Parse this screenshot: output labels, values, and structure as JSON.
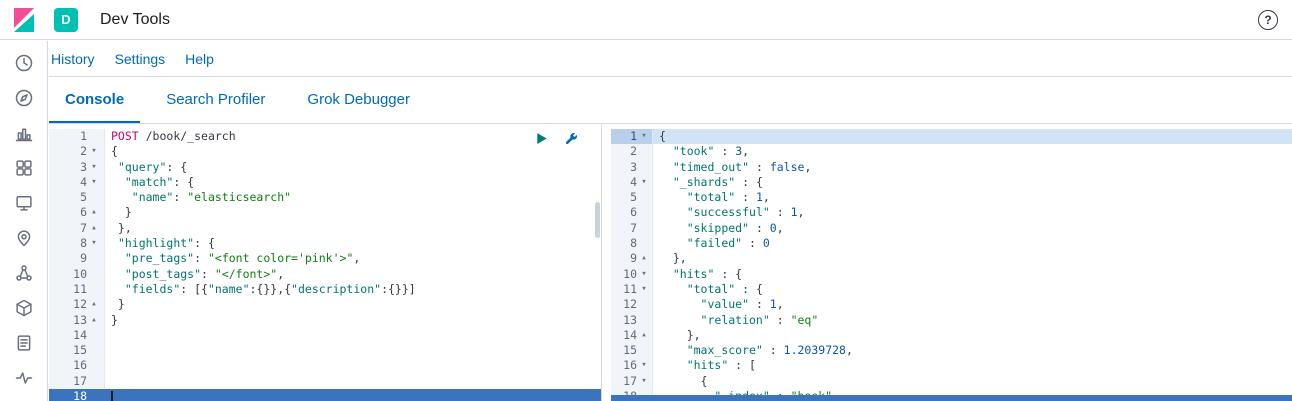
{
  "header": {
    "title": "Dev Tools",
    "space_badge": "D"
  },
  "topnav": {
    "links": [
      "History",
      "Settings",
      "Help"
    ]
  },
  "tabs": [
    {
      "label": "Console",
      "active": true
    },
    {
      "label": "Search Profiler",
      "active": false
    },
    {
      "label": "Grok Debugger",
      "active": false
    }
  ],
  "sidebar": {
    "icons": [
      "recently-viewed-icon",
      "discover-icon",
      "visualize-icon",
      "dashboard-icon",
      "canvas-icon",
      "maps-icon",
      "machine-learning-icon",
      "infrastructure-icon",
      "logs-icon",
      "apm-icon"
    ]
  },
  "colors": {
    "accent": "#006bb4",
    "space_badge": "#00bfb3",
    "logo_pink": "#f04e98",
    "logo_teal": "#00bfb3",
    "play_green": "#017d73",
    "active_line_blue": "#3b74ba"
  },
  "help_glyph": "?",
  "request_editor": {
    "active_line": 18,
    "lines": [
      {
        "n": 1,
        "fold": "",
        "seg": [
          [
            "method",
            "POST"
          ],
          [
            "url",
            " /book/_search"
          ]
        ]
      },
      {
        "n": 2,
        "fold": "down",
        "seg": [
          [
            "p",
            "{"
          ]
        ]
      },
      {
        "n": 3,
        "fold": "down",
        "seg": [
          [
            "p",
            " "
          ],
          [
            "k",
            "\"query\""
          ],
          [
            "p",
            ": {"
          ]
        ]
      },
      {
        "n": 4,
        "fold": "down",
        "seg": [
          [
            "p",
            "  "
          ],
          [
            "k",
            "\"match\""
          ],
          [
            "p",
            ": {"
          ]
        ]
      },
      {
        "n": 5,
        "fold": "",
        "seg": [
          [
            "p",
            "   "
          ],
          [
            "k",
            "\"name\""
          ],
          [
            "p",
            ": "
          ],
          [
            "s",
            "\"elasticsearch\""
          ]
        ]
      },
      {
        "n": 6,
        "fold": "up",
        "seg": [
          [
            "p",
            "  }"
          ]
        ]
      },
      {
        "n": 7,
        "fold": "up",
        "seg": [
          [
            "p",
            " },"
          ]
        ]
      },
      {
        "n": 8,
        "fold": "down",
        "seg": [
          [
            "p",
            " "
          ],
          [
            "k",
            "\"highlight\""
          ],
          [
            "p",
            ": {"
          ]
        ]
      },
      {
        "n": 9,
        "fold": "",
        "seg": [
          [
            "p",
            "  "
          ],
          [
            "k",
            "\"pre_tags\""
          ],
          [
            "p",
            ": "
          ],
          [
            "s",
            "\"<font color='pink'>\""
          ],
          [
            "p",
            ","
          ]
        ]
      },
      {
        "n": 10,
        "fold": "",
        "seg": [
          [
            "p",
            "  "
          ],
          [
            "k",
            "\"post_tags\""
          ],
          [
            "p",
            ": "
          ],
          [
            "s",
            "\"</font>\""
          ],
          [
            "p",
            ","
          ]
        ]
      },
      {
        "n": 11,
        "fold": "",
        "seg": [
          [
            "p",
            "  "
          ],
          [
            "k",
            "\"fields\""
          ],
          [
            "p",
            ": [{"
          ],
          [
            "k",
            "\"name\""
          ],
          [
            "p",
            ":{}},{"
          ],
          [
            "k",
            "\"description\""
          ],
          [
            "p",
            ":{}}]"
          ]
        ]
      },
      {
        "n": 12,
        "fold": "up",
        "seg": [
          [
            "p",
            " }"
          ]
        ]
      },
      {
        "n": 13,
        "fold": "up",
        "seg": [
          [
            "p",
            "}"
          ]
        ]
      },
      {
        "n": 14,
        "fold": "",
        "seg": []
      },
      {
        "n": 15,
        "fold": "",
        "seg": []
      },
      {
        "n": 16,
        "fold": "",
        "seg": []
      },
      {
        "n": 17,
        "fold": "",
        "seg": []
      },
      {
        "n": 18,
        "fold": "",
        "seg": []
      }
    ]
  },
  "response_editor": {
    "highlight_line": 1,
    "lines": [
      {
        "n": 1,
        "fold": "down",
        "seg": [
          [
            "p",
            "{"
          ]
        ]
      },
      {
        "n": 2,
        "fold": "",
        "seg": [
          [
            "p",
            "  "
          ],
          [
            "k",
            "\"took\""
          ],
          [
            "p",
            " : "
          ],
          [
            "n",
            "3"
          ],
          [
            "p",
            ","
          ]
        ]
      },
      {
        "n": 3,
        "fold": "",
        "seg": [
          [
            "p",
            "  "
          ],
          [
            "k",
            "\"timed_out\""
          ],
          [
            "p",
            " : "
          ],
          [
            "b",
            "false"
          ],
          [
            "p",
            ","
          ]
        ]
      },
      {
        "n": 4,
        "fold": "down",
        "seg": [
          [
            "p",
            "  "
          ],
          [
            "k",
            "\"_shards\""
          ],
          [
            "p",
            " : {"
          ]
        ]
      },
      {
        "n": 5,
        "fold": "",
        "seg": [
          [
            "p",
            "    "
          ],
          [
            "k",
            "\"total\""
          ],
          [
            "p",
            " : "
          ],
          [
            "n",
            "1"
          ],
          [
            "p",
            ","
          ]
        ]
      },
      {
        "n": 6,
        "fold": "",
        "seg": [
          [
            "p",
            "    "
          ],
          [
            "k",
            "\"successful\""
          ],
          [
            "p",
            " : "
          ],
          [
            "n",
            "1"
          ],
          [
            "p",
            ","
          ]
        ]
      },
      {
        "n": 7,
        "fold": "",
        "seg": [
          [
            "p",
            "    "
          ],
          [
            "k",
            "\"skipped\""
          ],
          [
            "p",
            " : "
          ],
          [
            "n",
            "0"
          ],
          [
            "p",
            ","
          ]
        ]
      },
      {
        "n": 8,
        "fold": "",
        "seg": [
          [
            "p",
            "    "
          ],
          [
            "k",
            "\"failed\""
          ],
          [
            "p",
            " : "
          ],
          [
            "n",
            "0"
          ]
        ]
      },
      {
        "n": 9,
        "fold": "up",
        "seg": [
          [
            "p",
            "  },"
          ]
        ]
      },
      {
        "n": 10,
        "fold": "down",
        "seg": [
          [
            "p",
            "  "
          ],
          [
            "k",
            "\"hits\""
          ],
          [
            "p",
            " : {"
          ]
        ]
      },
      {
        "n": 11,
        "fold": "down",
        "seg": [
          [
            "p",
            "    "
          ],
          [
            "k",
            "\"total\""
          ],
          [
            "p",
            " : {"
          ]
        ]
      },
      {
        "n": 12,
        "fold": "",
        "seg": [
          [
            "p",
            "      "
          ],
          [
            "k",
            "\"value\""
          ],
          [
            "p",
            " : "
          ],
          [
            "n",
            "1"
          ],
          [
            "p",
            ","
          ]
        ]
      },
      {
        "n": 13,
        "fold": "",
        "seg": [
          [
            "p",
            "      "
          ],
          [
            "k",
            "\"relation\""
          ],
          [
            "p",
            " : "
          ],
          [
            "s",
            "\"eq\""
          ]
        ]
      },
      {
        "n": 14,
        "fold": "up",
        "seg": [
          [
            "p",
            "    },"
          ]
        ]
      },
      {
        "n": 15,
        "fold": "",
        "seg": [
          [
            "p",
            "    "
          ],
          [
            "k",
            "\"max_score\""
          ],
          [
            "p",
            " : "
          ],
          [
            "n",
            "1.2039728"
          ],
          [
            "p",
            ","
          ]
        ]
      },
      {
        "n": 16,
        "fold": "down",
        "seg": [
          [
            "p",
            "    "
          ],
          [
            "k",
            "\"hits\""
          ],
          [
            "p",
            " : ["
          ]
        ]
      },
      {
        "n": 17,
        "fold": "down",
        "seg": [
          [
            "p",
            "      {"
          ]
        ]
      },
      {
        "n": 18,
        "fold": "",
        "seg": [
          [
            "p",
            "        "
          ],
          [
            "k",
            "\"_index\""
          ],
          [
            "p",
            " : "
          ],
          [
            "s",
            "\"book\""
          ],
          [
            "p",
            ","
          ]
        ]
      }
    ]
  }
}
